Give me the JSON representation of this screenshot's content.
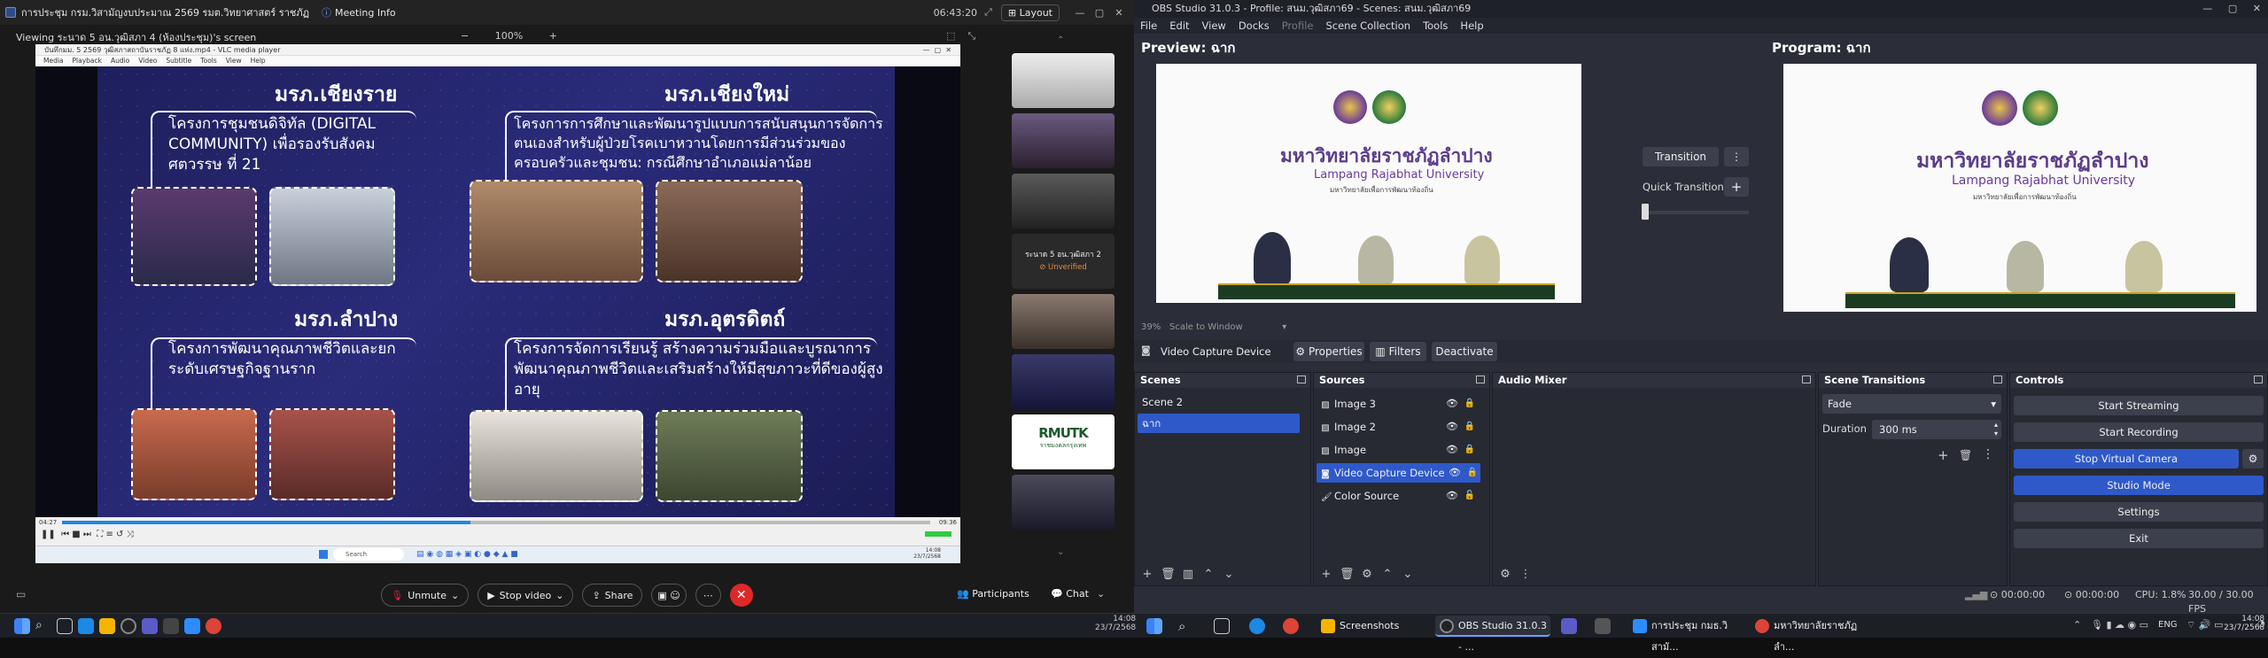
{
  "zoom": {
    "meeting_title": "การประชุม กรม.วิสามัญงบประมาณ 2569 รมต.วิทยาศาสตร์ ราชภัฏ",
    "meeting_info": "Meeting Info",
    "timer": "06:43:20",
    "layout_label": "Layout",
    "viewing_label": "Viewing ระนาด 5 อน.วุฒิสภา 4 (ห้องประชุม)'s screen",
    "zoom_minus": "−",
    "zoom_level": "100%",
    "zoom_plus": "+",
    "vlc_title": "บันทึกมม. 5 2569 วุฒิสภาสถาบันราชภัฏ 8 แห่ง.mp4 - VLC media player",
    "vlc_menu": [
      "Media",
      "Playback",
      "Audio",
      "Video",
      "Subtitle",
      "Tools",
      "View",
      "Help"
    ],
    "vlc_time_left": "04:27",
    "vlc_time_right": "09:36",
    "inner_search": "Search",
    "inner_clock": "14:08",
    "inner_date": "23/7/2568",
    "slide": {
      "t1": "มรภ.เชียงราย",
      "b1": "โครงการชุมชนดิจิทัล (DIGITAL COMMUNITY) เพื่อรองรับสังคมศตวรรษ ที่ 21",
      "t2": "มรภ.เชียงใหม่",
      "b2": "โครงการการศึกษาและพัฒนารูปแบบการสนับสนุนการจัดการตนเองสำหรับผู้ป่วยโรคเบาหวานโดยการมีส่วนร่วมของครอบครัวและชุมชน: กรณีศึกษาอำเภอแม่ลาน้อย",
      "t3": "มรภ.ลำปาง",
      "b3": "โครงการพัฒนาคุณภาพชีวิตและยกระดับเศรษฐกิจฐานราก",
      "t4": "มรภ.อุตรดิตถ์",
      "b4": "โครงการจัดการเรียนรู้ สร้างความร่วมมือและบูรณาการพัฒนาคุณภาพชีวิตและเสริมสร้างให้มีสุขภาวะที่ดีของผู้สูงอายุ"
    },
    "participant_tile_name": "ระนาด 5 อน.วุฒิสภา 2",
    "participant_tile_status": "Unverified",
    "rmutk_logo": "RMUTK",
    "rmutk_sub": "ราชมงคลกรุงเทพ",
    "bottom": {
      "unmute": "Unmute",
      "stop_video": "Stop video",
      "share": "Share",
      "participants": "Participants",
      "chat": "Chat"
    }
  },
  "obs": {
    "title": "OBS Studio 31.0.3 - Profile: สนม.วุฒิสภา69 - Scenes: สนม.วุฒิสภา69",
    "menu": [
      "File",
      "Edit",
      "View",
      "Docks",
      "Profile",
      "Scene Collection",
      "Tools",
      "Help"
    ],
    "preview_label": "Preview: ฉาก",
    "program_label": "Program: ฉาก",
    "uni_th": "มหาวิทยาลัยราชภัฏลำปาง",
    "uni_en": "Lampang Rajabhat University",
    "uni_sub": "มหาวิทยาลัยเพื่อการพัฒนาท้องถิ่น",
    "transition_label": "Transition",
    "quick_transitions": "Quick Transitions",
    "zoom_pct": "39%",
    "scale_label": "Scale to Window",
    "selected_source": "Video Capture Device",
    "properties": "Properties",
    "filters": "Filters",
    "deactivate": "Deactivate",
    "docks": {
      "scenes": "Scenes",
      "sources": "Sources",
      "audio_mixer": "Audio Mixer",
      "scene_transitions": "Scene Transitions",
      "controls": "Controls"
    },
    "scenes": [
      "Scene 2",
      "ฉาก"
    ],
    "sources": [
      "Image 3",
      "Image 2",
      "Image",
      "Video Capture Device",
      "Color Source"
    ],
    "transition_type": "Fade",
    "duration_label": "Duration",
    "duration_value": "300 ms",
    "controls": [
      "Start Streaming",
      "Start Recording",
      "Stop Virtual Camera",
      "Studio Mode",
      "Settings",
      "Exit"
    ],
    "status": {
      "stream_time": "00:00:00",
      "rec_time": "00:00:00",
      "cpu": "CPU: 1.8%",
      "fps": "30.00 / 30.00 FPS"
    }
  },
  "taskbar": {
    "tabs": [
      "Screenshots",
      "OBS Studio 31.0.3 - ...",
      "การประชุม กมธ.วิสามั...",
      "มหาวิทยาลัยราชภัฏลำ..."
    ],
    "lang": "ENG",
    "time_right": "14:08",
    "date_right": "23/7/2568",
    "time_left": "14:08",
    "date_left": "23/7/2568"
  }
}
